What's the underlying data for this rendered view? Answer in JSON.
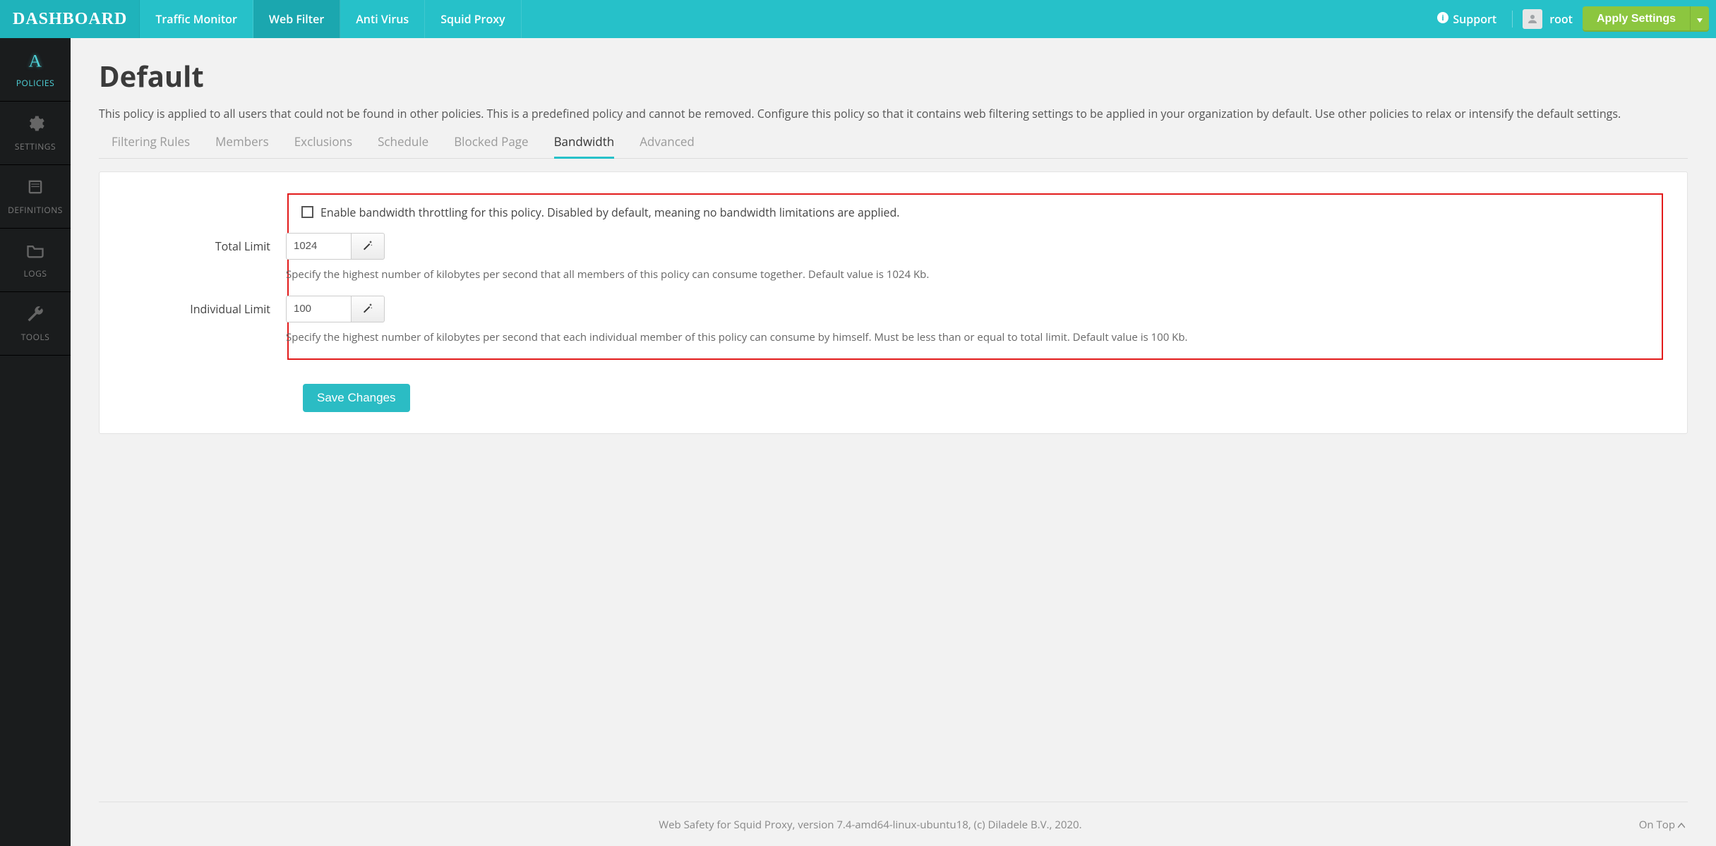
{
  "brand": "DASHBOARD",
  "topnav": [
    {
      "label": "Traffic Monitor",
      "active": false
    },
    {
      "label": "Web Filter",
      "active": true
    },
    {
      "label": "Anti Virus",
      "active": false
    },
    {
      "label": "Squid Proxy",
      "active": false
    }
  ],
  "support_label": "Support",
  "username": "root",
  "apply_label": "Apply Settings",
  "sidebar": [
    {
      "id": "policies",
      "label": "POLICIES",
      "active": true
    },
    {
      "id": "settings",
      "label": "SETTINGS",
      "active": false
    },
    {
      "id": "definitions",
      "label": "DEFINITIONS",
      "active": false
    },
    {
      "id": "logs",
      "label": "LOGS",
      "active": false
    },
    {
      "id": "tools",
      "label": "TOOLS",
      "active": false
    }
  ],
  "page": {
    "title": "Default",
    "description": "This policy is applied to all users that could not be found in other policies. This is a predefined policy and cannot be removed. Configure this policy so that it contains web filtering settings to be applied in your organization by default. Use other policies to relax or intensify the default settings."
  },
  "tabs": [
    {
      "label": "Filtering Rules",
      "active": false
    },
    {
      "label": "Members",
      "active": false
    },
    {
      "label": "Exclusions",
      "active": false
    },
    {
      "label": "Schedule",
      "active": false
    },
    {
      "label": "Blocked Page",
      "active": false
    },
    {
      "label": "Bandwidth",
      "active": true
    },
    {
      "label": "Advanced",
      "active": false
    }
  ],
  "form": {
    "enable_label": "Enable bandwidth throttling for this policy. Disabled by default, meaning no bandwidth limitations are applied.",
    "enable_checked": false,
    "total": {
      "label": "Total Limit",
      "value": "1024",
      "help": "Specify the highest number of kilobytes per second that all members of this policy can consume together. Default value is 1024 Kb."
    },
    "individual": {
      "label": "Individual Limit",
      "value": "100",
      "help": "Specify the highest number of kilobytes per second that each individual member of this policy can consume by himself. Must be less than or equal to total limit. Default value is 100 Kb."
    },
    "save_label": "Save Changes"
  },
  "footer": {
    "text": "Web Safety for Squid Proxy, version 7.4-amd64-linux-ubuntu18, (c) Diladele B.V., 2020.",
    "ontop": "On Top"
  }
}
